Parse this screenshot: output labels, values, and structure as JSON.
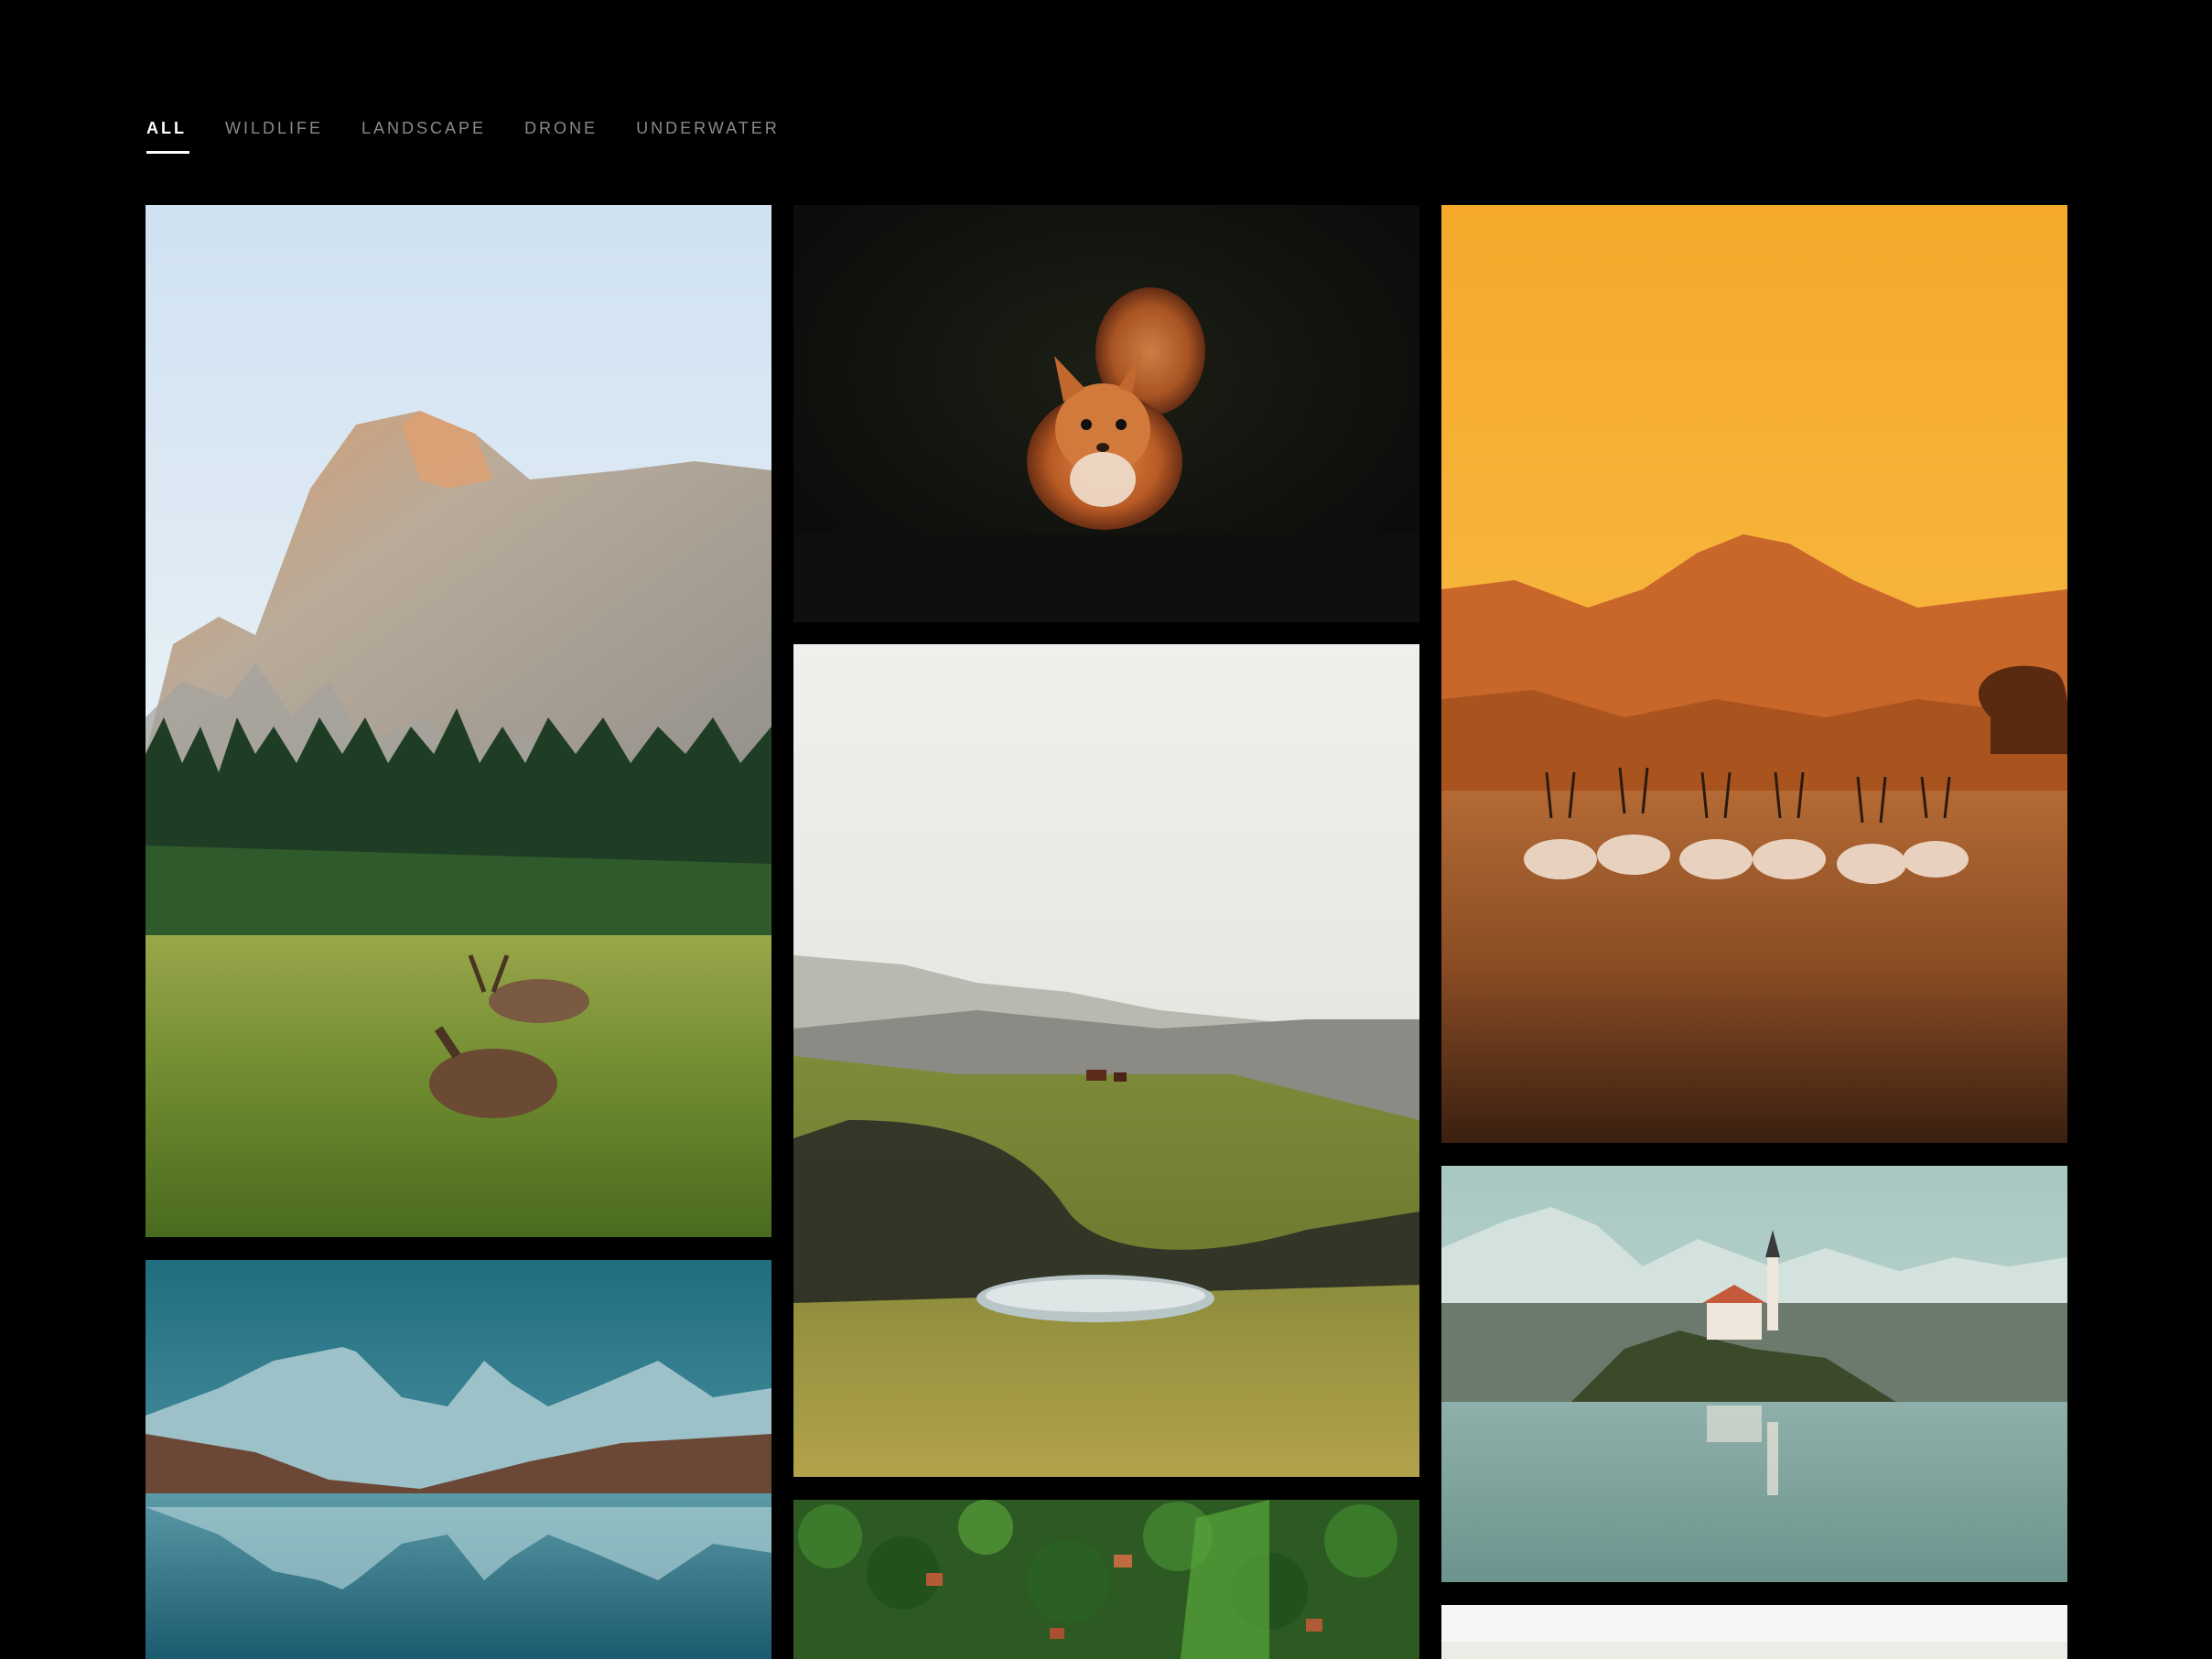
{
  "filters": {
    "items": [
      {
        "label": "ALL",
        "active": true
      },
      {
        "label": "WILDLIFE",
        "active": false
      },
      {
        "label": "LANDSCAPE",
        "active": false
      },
      {
        "label": "DRONE",
        "active": false
      },
      {
        "label": "UNDERWATER",
        "active": false
      }
    ]
  },
  "gallery": {
    "photos": [
      {
        "subject": "half-dome-deer-meadow"
      },
      {
        "subject": "alpine-lake-reflection"
      },
      {
        "subject": "red-squirrel-dark"
      },
      {
        "subject": "rolling-hills-pond"
      },
      {
        "subject": "aerial-forest-village"
      },
      {
        "subject": "oryx-herd-sunset-desert"
      },
      {
        "subject": "lake-bled-church-island"
      },
      {
        "subject": "light-partial-photo"
      }
    ]
  },
  "colors": {
    "background": "#000000",
    "tab_active": "#ffffff",
    "tab_inactive": "#8a8a8a"
  }
}
